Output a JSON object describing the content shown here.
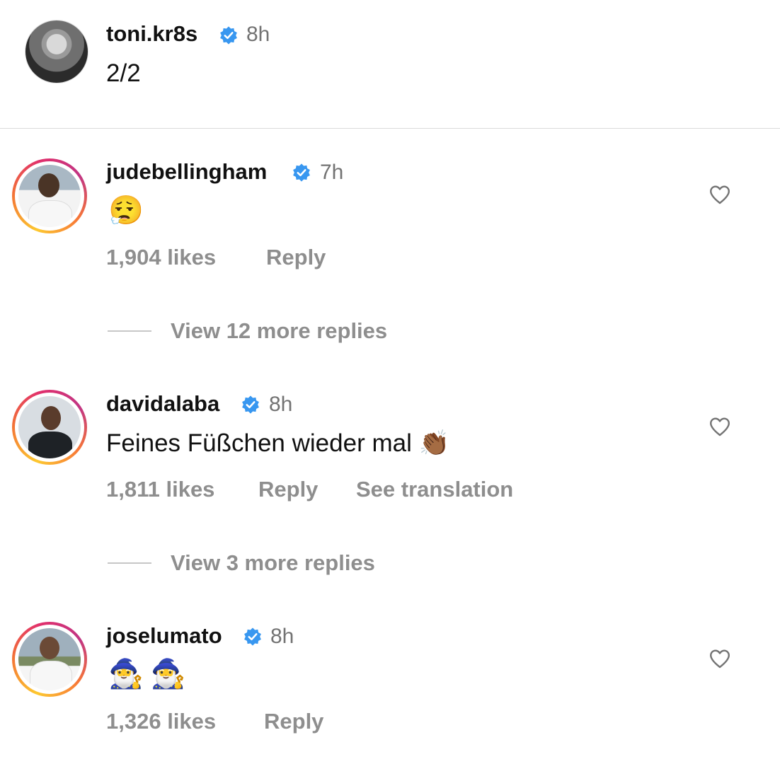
{
  "caption": {
    "username": "toni.kr8s",
    "time": "8h",
    "text": "2/2"
  },
  "comments": [
    {
      "username": "judebellingham",
      "time": "7h",
      "text": "😮‍💨",
      "likes": "1,904 likes",
      "reply_label": "Reply",
      "view_replies": "View 12 more replies"
    },
    {
      "username": "davidalaba",
      "time": "8h",
      "text": "Feines Füßchen wieder mal 👏🏾",
      "likes": "1,811 likes",
      "reply_label": "Reply",
      "translate_label": "See translation",
      "view_replies": "View 3 more replies"
    },
    {
      "username": "joselumato",
      "time": "8h",
      "text": "🧙‍♂️🧙‍♂️",
      "likes": "1,326 likes",
      "reply_label": "Reply"
    }
  ],
  "icons": {
    "verified": "verified-badge-icon",
    "like": "heart-outline-icon"
  },
  "colors": {
    "verified_blue": "#3897f0",
    "meta_gray": "#8e8e8e",
    "divider": "#dbdbdb",
    "story_ring": [
      "#fdc830",
      "#f37335",
      "#e1306c",
      "#c13584"
    ]
  }
}
